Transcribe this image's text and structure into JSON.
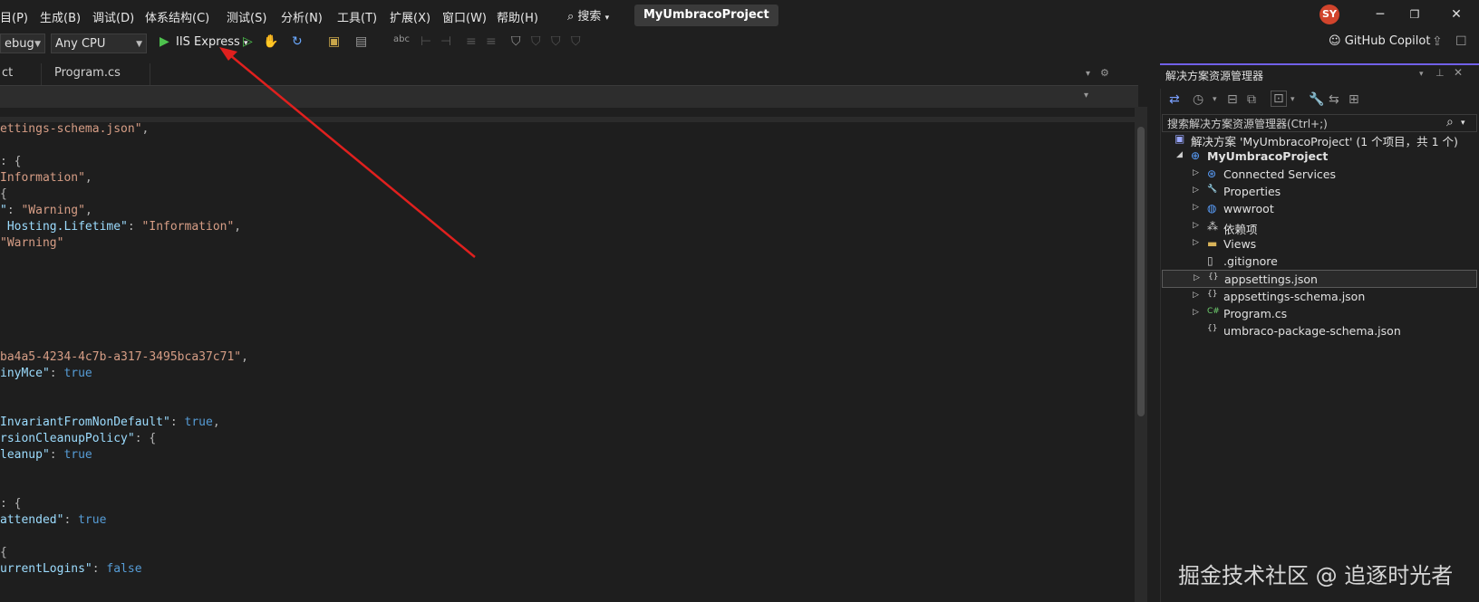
{
  "menu": {
    "items": [
      "目(P)",
      "生成(B)",
      "调试(D)",
      "体系结构(C)",
      "测试(S)",
      "分析(N)",
      "工具(T)",
      "扩展(X)",
      "窗口(W)",
      "帮助(H)"
    ],
    "search_label": "搜索",
    "project_name": "MyUmbracoProject",
    "user_initials": "SY"
  },
  "toolbar": {
    "config_value": "ebug",
    "platform_value": "Any CPU",
    "run_label": "IIS Express",
    "copilot_label": "GitHub Copilot"
  },
  "editor": {
    "tabs": [
      "ct",
      "Program.cs"
    ],
    "lines": [
      [
        {
          "t": "ettings-schema.json\"",
          "c": "str"
        },
        {
          "t": ",",
          "c": "pun"
        }
      ],
      [],
      [
        {
          "t": ": {",
          "c": "pun"
        }
      ],
      [
        {
          "t": "Information\"",
          "c": "str"
        },
        {
          "t": ",",
          "c": "pun"
        }
      ],
      [
        {
          "t": "{",
          "c": "pun"
        }
      ],
      [
        {
          "t": "\"",
          "c": "key"
        },
        {
          "t": ": ",
          "c": "pun"
        },
        {
          "t": "\"Warning\"",
          "c": "str"
        },
        {
          "t": ",",
          "c": "pun"
        }
      ],
      [
        {
          "t": " Hosting.Lifetime\"",
          "c": "key"
        },
        {
          "t": ": ",
          "c": "pun"
        },
        {
          "t": "\"Information\"",
          "c": "str"
        },
        {
          "t": ",",
          "c": "pun"
        }
      ],
      [
        {
          "t": "\"Warning\"",
          "c": "str"
        }
      ],
      [],
      [],
      [],
      [],
      [],
      [],
      [
        {
          "t": "ba4a5-4234-4c7b-a317-3495bca37c71\"",
          "c": "str"
        },
        {
          "t": ",",
          "c": "pun"
        }
      ],
      [
        {
          "t": "inyMce\"",
          "c": "key"
        },
        {
          "t": ": ",
          "c": "pun"
        },
        {
          "t": "true",
          "c": "kw"
        }
      ],
      [],
      [],
      [
        {
          "t": "InvariantFromNonDefault\"",
          "c": "key"
        },
        {
          "t": ": ",
          "c": "pun"
        },
        {
          "t": "true",
          "c": "kw"
        },
        {
          "t": ",",
          "c": "pun"
        }
      ],
      [
        {
          "t": "rsionCleanupPolicy\"",
          "c": "key"
        },
        {
          "t": ": {",
          "c": "pun"
        }
      ],
      [
        {
          "t": "leanup\"",
          "c": "key"
        },
        {
          "t": ": ",
          "c": "pun"
        },
        {
          "t": "true",
          "c": "kw"
        }
      ],
      [],
      [],
      [
        {
          "t": ": {",
          "c": "pun"
        }
      ],
      [
        {
          "t": "attended\"",
          "c": "key"
        },
        {
          "t": ": ",
          "c": "pun"
        },
        {
          "t": "true",
          "c": "kw"
        }
      ],
      [],
      [
        {
          "t": "{",
          "c": "pun"
        }
      ],
      [
        {
          "t": "urrentLogins\"",
          "c": "key"
        },
        {
          "t": ": ",
          "c": "pun"
        },
        {
          "t": "false",
          "c": "kw"
        }
      ]
    ]
  },
  "solution_explorer": {
    "title": "解决方案资源管理器",
    "search_placeholder": "搜索解决方案资源管理器(Ctrl+;)",
    "items": [
      {
        "label": "解决方案 'MyUmbracoProject' (1 个项目，共 1 个)",
        "indent": 0,
        "arrow": "",
        "icon": "solution-icon"
      },
      {
        "label": "MyUmbracoProject",
        "indent": 1,
        "arrow": "down",
        "icon": "web-project-icon",
        "bold": true
      },
      {
        "label": "Connected Services",
        "indent": 2,
        "arrow": "right",
        "icon": "connected-services-icon"
      },
      {
        "label": "Properties",
        "indent": 2,
        "arrow": "right",
        "icon": "properties-icon"
      },
      {
        "label": "wwwroot",
        "indent": 2,
        "arrow": "right",
        "icon": "globe-icon"
      },
      {
        "label": "依赖项",
        "indent": 2,
        "arrow": "right",
        "icon": "dependencies-icon"
      },
      {
        "label": "Views",
        "indent": 2,
        "arrow": "right",
        "icon": "folder-icon"
      },
      {
        "label": ".gitignore",
        "indent": 2,
        "arrow": "",
        "icon": "file-icon"
      },
      {
        "label": "appsettings.json",
        "indent": 2,
        "arrow": "right",
        "icon": "json-file-icon",
        "selected": true
      },
      {
        "label": "appsettings-schema.json",
        "indent": 2,
        "arrow": "right",
        "icon": "json-file-icon"
      },
      {
        "label": "Program.cs",
        "indent": 2,
        "arrow": "right",
        "icon": "csharp-file-icon"
      },
      {
        "label": "umbraco-package-schema.json",
        "indent": 2,
        "arrow": "",
        "icon": "json-file-icon"
      }
    ]
  },
  "watermark": "掘金技术社区 @ 追逐时光者",
  "colors": {
    "accent": "#7160e8",
    "annotation_arrow": "#e0201e",
    "run_green": "#4ec24e"
  }
}
